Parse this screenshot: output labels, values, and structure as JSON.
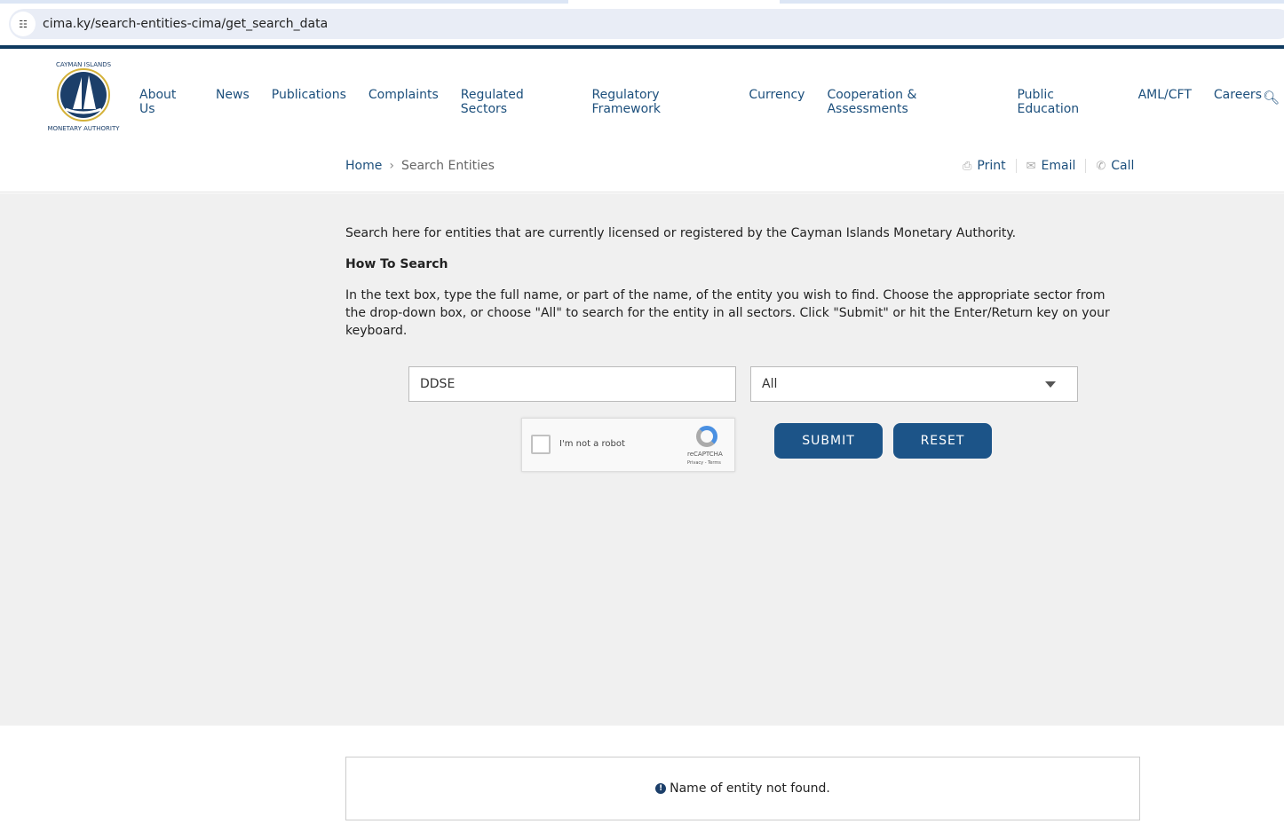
{
  "browser": {
    "url": "cima.ky/search-entities-cima/get_search_data"
  },
  "header": {
    "logo_text": "CAYMAN ISLANDS MONETARY AUTHORITY",
    "nav": [
      "About Us",
      "News",
      "Publications",
      "Complaints",
      "Regulated Sectors",
      "Regulatory Framework",
      "Currency",
      "Cooperation & Assessments",
      "Public Education",
      "AML/CFT",
      "Careers"
    ],
    "breadcrumb": {
      "home": "Home",
      "current": "Search Entities"
    },
    "actions": {
      "print": "Print",
      "email": "Email",
      "call": "Call"
    }
  },
  "main": {
    "intro": "Search here for entities that are currently licensed or registered by the Cayman Islands Monetary Authority.",
    "howto_title": "How To Search",
    "howto_text": "In the text box, type the full name, or part of the name, of the entity you wish to find. Choose the appropriate sector from the drop-down box, or choose \"All\" to search for the entity in all sectors. Click \"Submit\" or hit the Enter/Return key on your keyboard.",
    "search_value": "DDSE",
    "sector_value": "All",
    "captcha": {
      "label": "I'm not a robot",
      "brand": "reCAPTCHA",
      "terms": "Privacy - Terms"
    },
    "submit": "SUBMIT",
    "reset": "RESET"
  },
  "result": {
    "message": "Name of entity not found."
  }
}
